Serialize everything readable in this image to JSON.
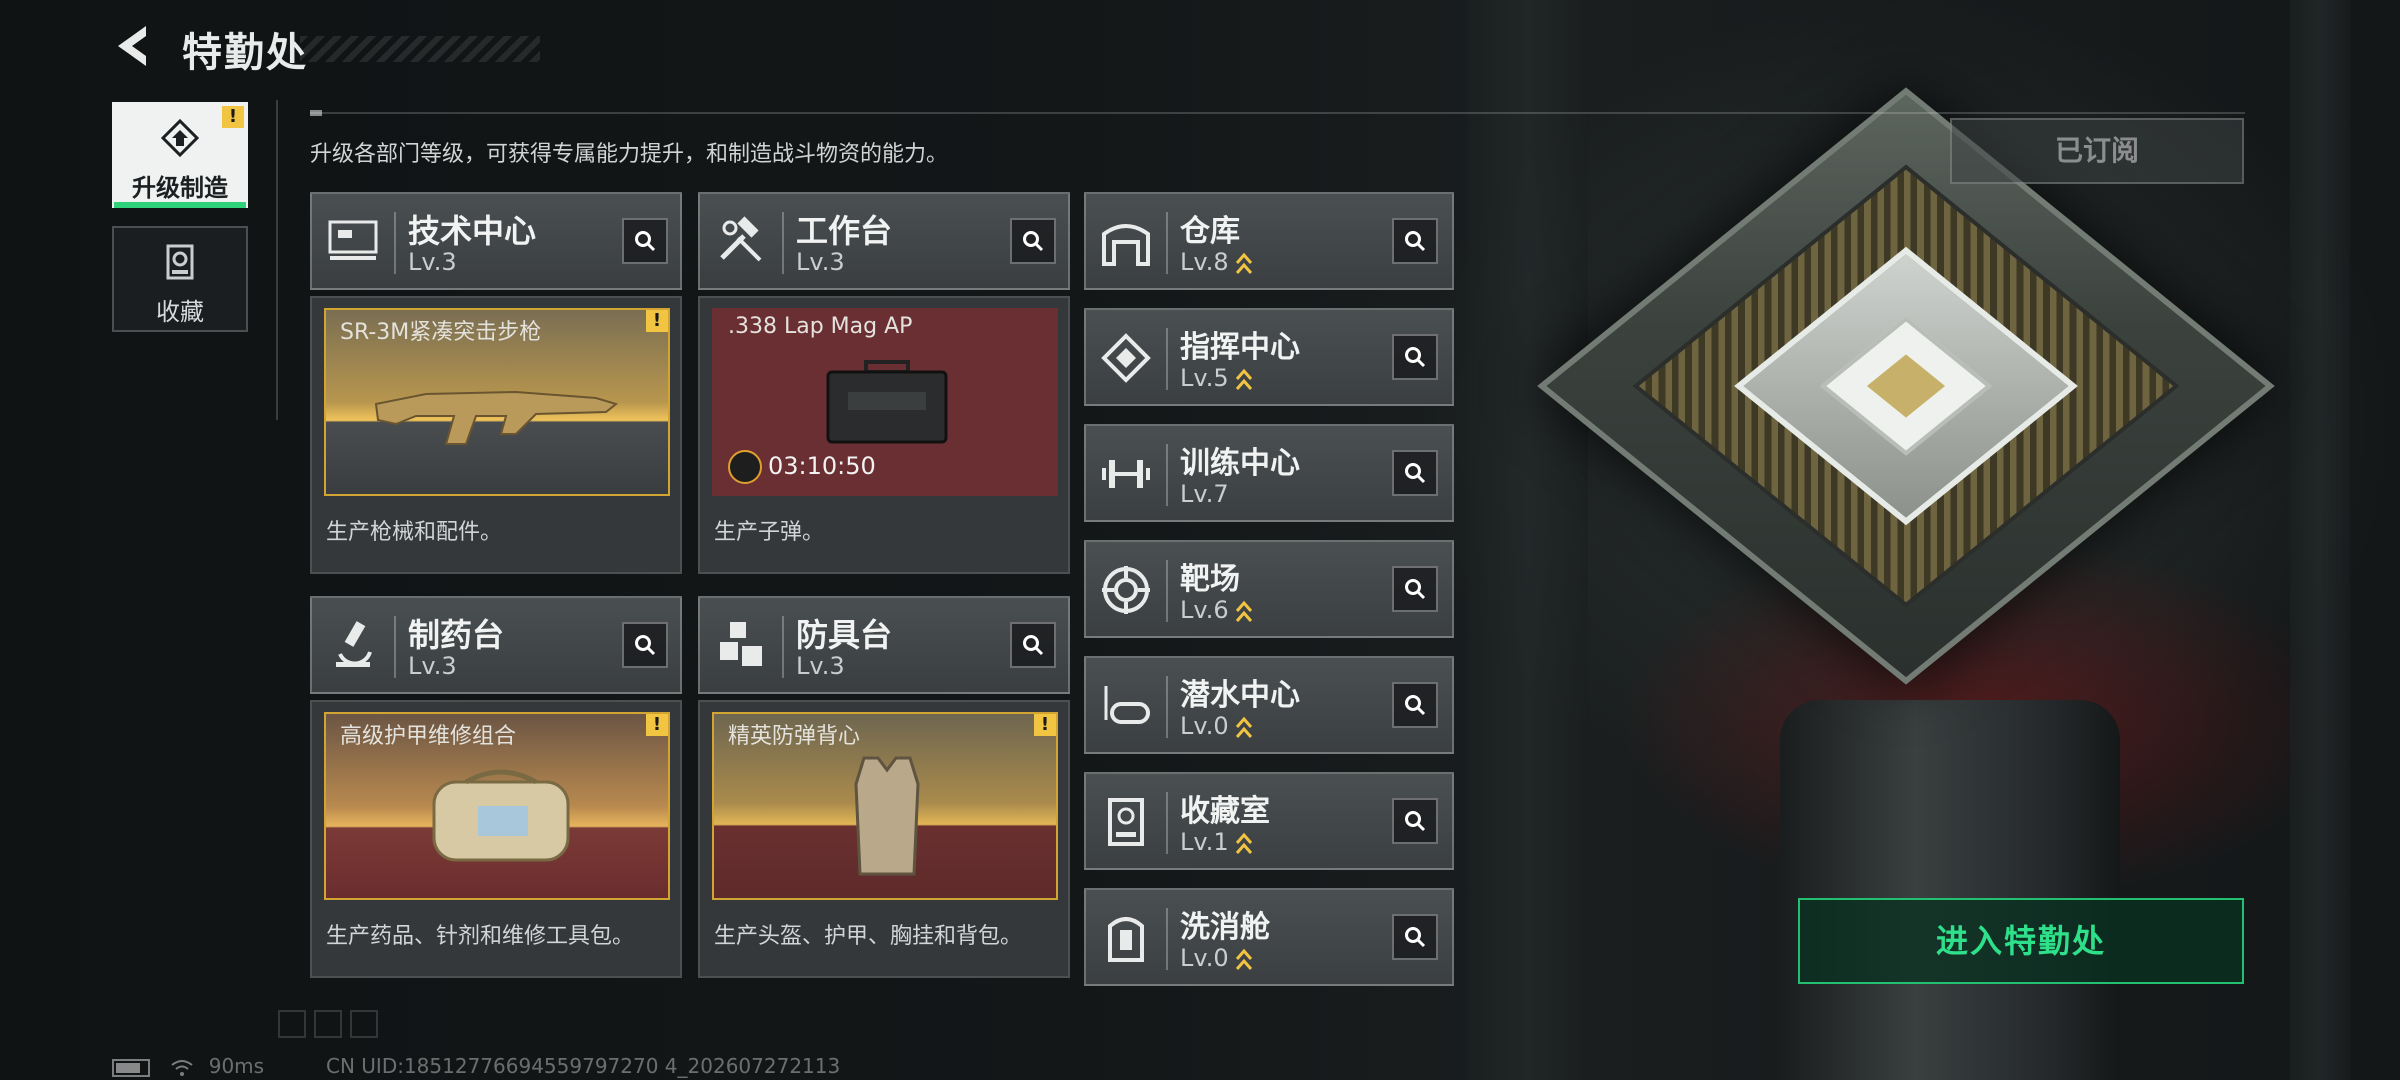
{
  "header": {
    "title": "特勤处"
  },
  "tabs": [
    {
      "label": "升级制造",
      "active": true,
      "icon": "upgrade-icon",
      "alert": "!"
    },
    {
      "label": "收藏",
      "active": false,
      "icon": "collection-icon"
    }
  ],
  "intro_text": "升级各部门等级，可获得专属能力提升，和制造战斗物资的能力。",
  "subscribed_label": "已订阅",
  "workshops": [
    {
      "name": "技术中心",
      "level": "Lv.3",
      "icon": "monitor-icon",
      "item": "SR-3M紧凑突击步枪",
      "item_alert": "!",
      "timer": "",
      "description": "生产枪械和配件。"
    },
    {
      "name": "工作台",
      "level": "Lv.3",
      "icon": "hammer-wrench-icon",
      "item": ".338 Lap Mag AP",
      "item_alert": "",
      "timer": "03:10:50",
      "description": "生产子弹。"
    },
    {
      "name": "制药台",
      "level": "Lv.3",
      "icon": "microscope-icon",
      "item": "高级护甲维修组合",
      "item_alert": "!",
      "timer": "",
      "description": "生产药品、针剂和维修工具包。"
    },
    {
      "name": "防具台",
      "level": "Lv.3",
      "icon": "cubes-icon",
      "item": "精英防弹背心",
      "item_alert": "!",
      "timer": "",
      "description": "生产头盔、护甲、胸挂和背包。"
    }
  ],
  "departments": [
    {
      "name": "仓库",
      "level": "Lv.8",
      "upgradable": true,
      "icon": "warehouse-icon"
    },
    {
      "name": "指挥中心",
      "level": "Lv.5",
      "upgradable": true,
      "icon": "chip-icon"
    },
    {
      "name": "训练中心",
      "level": "Lv.7",
      "upgradable": false,
      "icon": "dumbbell-icon"
    },
    {
      "name": "靶场",
      "level": "Lv.6",
      "upgradable": true,
      "icon": "target-icon"
    },
    {
      "name": "潜水中心",
      "level": "Lv.0",
      "upgradable": true,
      "icon": "diving-mask-icon"
    },
    {
      "name": "收藏室",
      "level": "Lv.1",
      "upgradable": true,
      "icon": "display-case-icon"
    },
    {
      "name": "洗消舱",
      "level": "Lv.0",
      "upgradable": true,
      "icon": "decon-pod-icon"
    }
  ],
  "enter_button": "进入特勤处",
  "status": {
    "ping": "90ms",
    "uid": "CN UID:18512776694559797270 4_202607272113"
  },
  "colors": {
    "accent_green": "#2fe08a",
    "gold": "#d2a431",
    "warning": "#f1c542"
  }
}
